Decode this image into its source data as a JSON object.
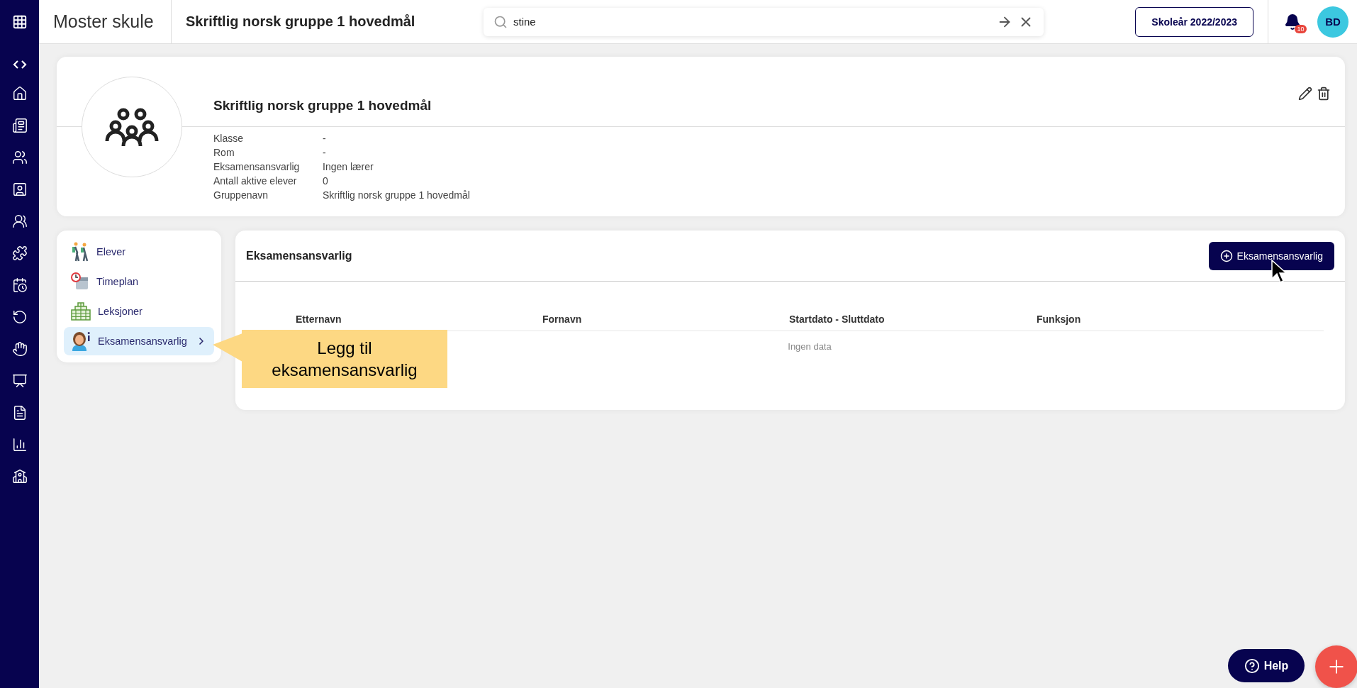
{
  "app": {
    "title": "Moster skule"
  },
  "page_title": "Skriftlig norsk gruppe 1 hovedmål",
  "search": {
    "value": "stine"
  },
  "school_year": "Skoleår 2022/2023",
  "notifications": {
    "count": "10"
  },
  "user": {
    "initials": "BD"
  },
  "group": {
    "title": "Skriftlig norsk gruppe 1 hovedmål",
    "details": [
      {
        "label": "Klasse",
        "value": "-"
      },
      {
        "label": "Rom",
        "value": "-"
      },
      {
        "label": "Eksamensansvarlig",
        "value": "Ingen lærer"
      },
      {
        "label": "Antall aktive elever",
        "value": "0"
      },
      {
        "label": "Gruppenavn",
        "value": "Skriftlig norsk gruppe 1 hovedmål"
      }
    ]
  },
  "menu": [
    {
      "kind": "students",
      "label": "Elever",
      "selected": false
    },
    {
      "kind": "schedule",
      "label": "Timeplan",
      "selected": false
    },
    {
      "kind": "lessons",
      "label": "Leksjoner",
      "selected": false
    },
    {
      "kind": "examiner",
      "label": "Eksamensansvarlig",
      "selected": true
    }
  ],
  "section": {
    "title": "Eksamensansvarlig",
    "add_button": "Eksamensansvarlig",
    "columns": [
      "Etternavn",
      "Fornavn",
      "Startdato - Sluttdato",
      "Funksjon"
    ],
    "empty_text": "Ingen data"
  },
  "callout": {
    "text": "Legg til eksamensansvarlig"
  },
  "help_button": {
    "label": "Help"
  }
}
